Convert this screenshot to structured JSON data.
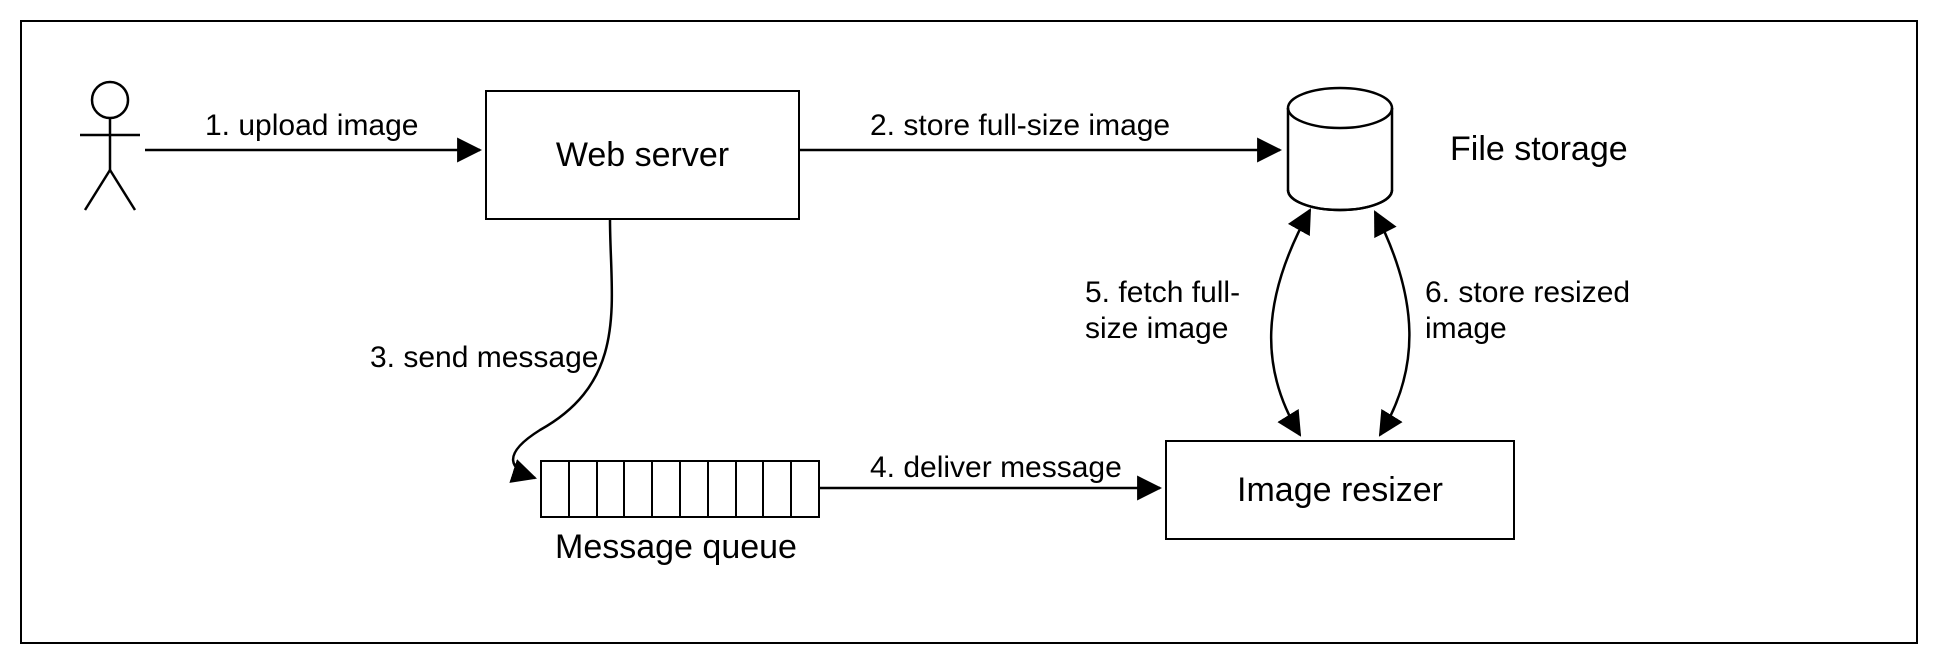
{
  "nodes": {
    "user": {
      "label": ""
    },
    "web_server": {
      "label": "Web server"
    },
    "file_storage": {
      "label": "File storage"
    },
    "message_queue": {
      "label": "Message queue"
    },
    "image_resizer": {
      "label": "Image resizer"
    }
  },
  "edges": {
    "upload_image": {
      "label": "1. upload image"
    },
    "store_full": {
      "label": "2. store full-size image"
    },
    "send_message": {
      "label": "3. send message"
    },
    "deliver_message": {
      "label": "4. deliver message"
    },
    "fetch_full": {
      "label": "5. fetch full-\nsize image"
    },
    "store_resized": {
      "label": "6. store resized\nimage"
    }
  }
}
